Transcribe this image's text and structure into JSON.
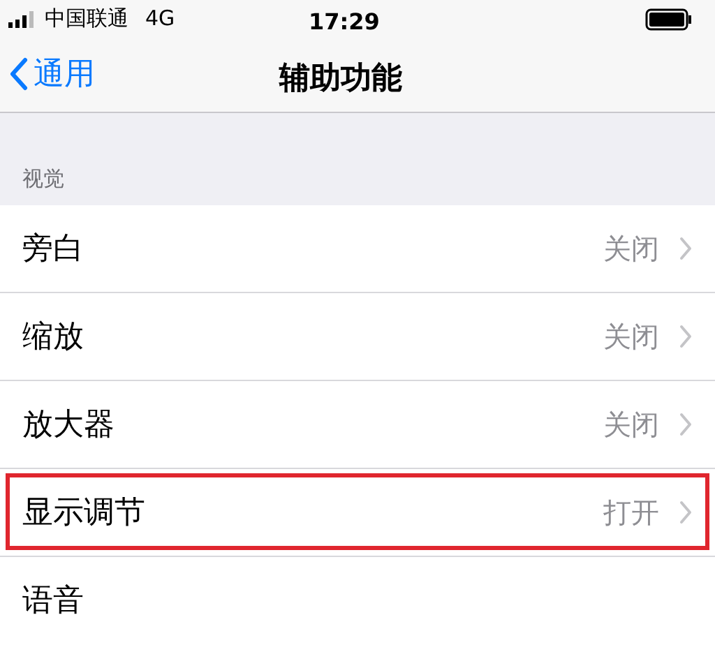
{
  "status_bar": {
    "carrier": "中国联通",
    "network": "4G",
    "time": "17:29"
  },
  "nav_bar": {
    "back": "通用",
    "title": "辅助功能"
  },
  "section": {
    "header": "视觉",
    "rows": [
      {
        "label": "旁白",
        "value": "关闭",
        "highlighted": false
      },
      {
        "label": "缩放",
        "value": "关闭",
        "highlighted": false
      },
      {
        "label": "放大器",
        "value": "关闭",
        "highlighted": false
      },
      {
        "label": "显示调节",
        "value": "打开",
        "highlighted": true
      },
      {
        "label": "语音"
      }
    ]
  }
}
